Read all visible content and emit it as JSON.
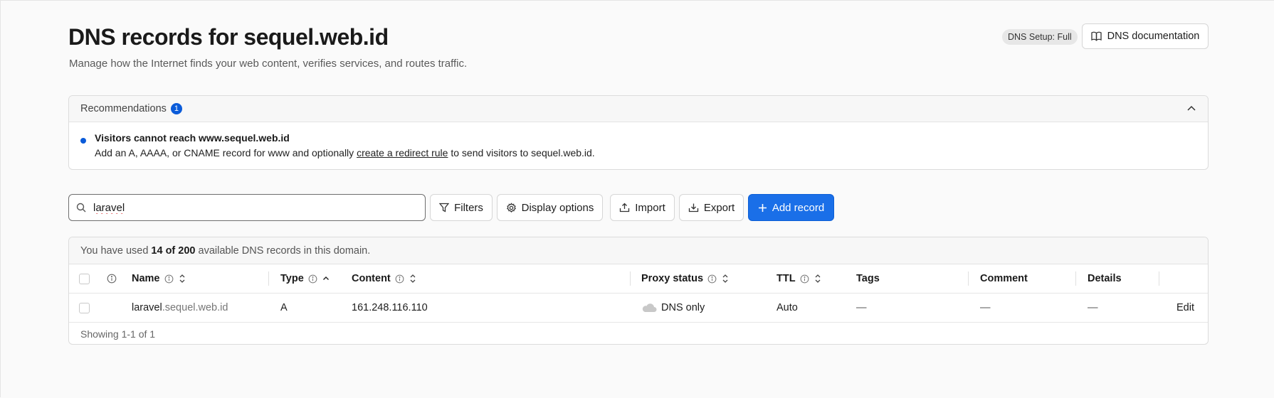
{
  "header": {
    "title": "DNS records for sequel.web.id",
    "subtitle": "Manage how the Internet finds your web content, verifies services, and routes traffic.",
    "badge": "DNS Setup: Full",
    "doc_button": "DNS documentation"
  },
  "recommendations": {
    "label": "Recommendations",
    "count": "1",
    "item_title": "Visitors cannot reach www.sequel.web.id",
    "item_text_before": "Add an A, AAAA, or CNAME record for www and optionally ",
    "item_link": "create a redirect rule",
    "item_text_after": " to send visitors to sequel.web.id."
  },
  "toolbar": {
    "search_value": "laravel",
    "filters": "Filters",
    "display_options": "Display options",
    "import": "Import",
    "export": "Export",
    "add_record": "Add record"
  },
  "usage": {
    "before": "You have used",
    "count": "14 of 200",
    "after": "available DNS records in this domain."
  },
  "table": {
    "columns": {
      "name": "Name",
      "type": "Type",
      "content": "Content",
      "proxy": "Proxy status",
      "ttl": "TTL",
      "tags": "Tags",
      "comment": "Comment",
      "details": "Details"
    },
    "rows": [
      {
        "name_sub": "laravel",
        "name_domain": ".sequel.web.id",
        "type": "A",
        "content": "161.248.116.110",
        "proxy": "DNS only",
        "ttl": "Auto",
        "tags": "—",
        "comment": "—",
        "details": "—",
        "action": "Edit"
      }
    ],
    "footer": "Showing 1-1 of 1"
  },
  "colors": {
    "accent": "#1a6fe8",
    "badge_dot": "#0a5bd9"
  }
}
